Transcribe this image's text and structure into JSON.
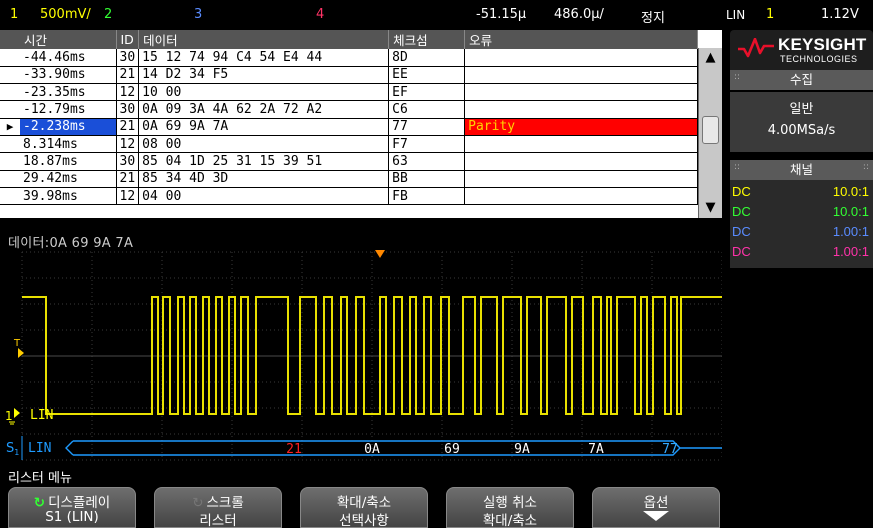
{
  "status": {
    "ch1_num": "1",
    "ch1_scale": "500mV/",
    "ch2_num": "2",
    "ch3_num": "3",
    "ch4_num": "4",
    "time_offset": "-51.15µ",
    "time_scale": "486.0µ/",
    "run_state": "정지",
    "trigger_type": "LIN",
    "trigger_source": "1",
    "trigger_level": "1.12V"
  },
  "lister": {
    "headers": [
      "시간",
      "ID",
      "데이터",
      "체크섬",
      "오류"
    ],
    "rows": [
      {
        "time": "-44.46ms",
        "id": "30",
        "data": "15 12 74 94 C4 54 E4 44",
        "checksum": "8D",
        "error": ""
      },
      {
        "time": "-33.90ms",
        "id": "21",
        "data": "14 D2 34 F5",
        "checksum": "EE",
        "error": ""
      },
      {
        "time": "-23.35ms",
        "id": "12",
        "data": "10 00",
        "checksum": "EF",
        "error": ""
      },
      {
        "time": "-12.79ms",
        "id": "30",
        "data": "0A 09 3A 4A 62 2A 72 A2",
        "checksum": "C6",
        "error": ""
      },
      {
        "time": "-2.238ms",
        "id": "21",
        "data": "0A 69 9A 7A",
        "checksum": "77",
        "error": "Parity"
      },
      {
        "time": "8.314ms",
        "id": "12",
        "data": "08 00",
        "checksum": "F7",
        "error": ""
      },
      {
        "time": "18.87ms",
        "id": "30",
        "data": "85 04 1D 25 31 15 39 51",
        "checksum": "63",
        "error": ""
      },
      {
        "time": "29.42ms",
        "id": "21",
        "data": "85 34 4D 3D",
        "checksum": "BB",
        "error": ""
      },
      {
        "time": "39.98ms",
        "id": "12",
        "data": "04 00",
        "checksum": "FB",
        "error": ""
      }
    ],
    "selected_row": 4
  },
  "decode_line": "데이터:0A 69 9A 7A",
  "waveform": {
    "ch1_label": "LIN",
    "s1_label": "S",
    "s1_sub": "1",
    "s1_channel": "LIN",
    "bus_values": [
      {
        "text": "21",
        "color": "#ff2020"
      },
      {
        "text": "0A",
        "color": "#ffffff"
      },
      {
        "text": "69",
        "color": "#ffffff"
      },
      {
        "text": "9A",
        "color": "#ffffff"
      },
      {
        "text": "7A",
        "color": "#ffffff"
      },
      {
        "text": "77",
        "color": "#33aaff"
      }
    ],
    "trace_color": "#e8e000",
    "bus_color": "#1e9bff"
  },
  "brand": {
    "name": "KEYSIGHT",
    "sub": "TECHNOLOGIES"
  },
  "acquisition": {
    "title": "수집",
    "mode": "일반",
    "rate": "4.00MSa/s"
  },
  "channels": {
    "title": "채널",
    "rows": [
      {
        "coupling": "DC",
        "probe": "10.0:1",
        "color": "#ffff00"
      },
      {
        "coupling": "DC",
        "probe": "10.0:1",
        "color": "#33ff33"
      },
      {
        "coupling": "DC",
        "probe": "1.00:1",
        "color": "#5a8cff"
      },
      {
        "coupling": "DC",
        "probe": "1.00:1",
        "color": "#ff33aa"
      }
    ]
  },
  "menu": {
    "title": "리스터 메뉴",
    "softkeys": [
      {
        "line1": "디스플레이",
        "line2": "S1 (LIN)"
      },
      {
        "line1": "스크롤",
        "line2": "리스터"
      },
      {
        "line1": "확대/축소",
        "line2": "선택사항"
      },
      {
        "line1": "실행 취소",
        "line2": "확대/축소"
      },
      {
        "line1": "옵션",
        "line2": ""
      }
    ]
  }
}
